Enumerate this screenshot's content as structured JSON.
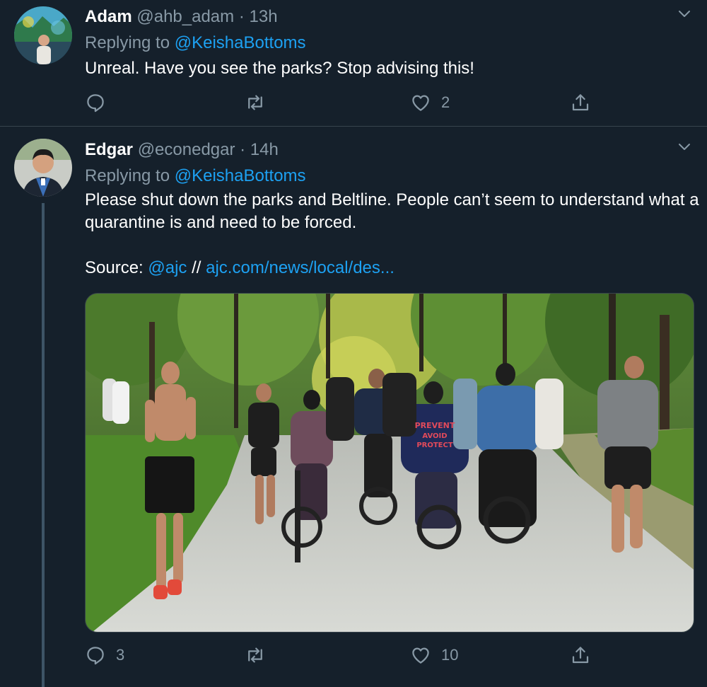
{
  "tweets": [
    {
      "name": "Adam",
      "handle": "@ahb_adam",
      "separator": "·",
      "time": "13h",
      "replying_prefix": "Replying to",
      "replying_to": "@KeishaBottoms",
      "text": "Unreal. Have you see the parks? Stop advising this!",
      "reply_count": "",
      "like_count": "2"
    },
    {
      "name": "Edgar",
      "handle": "@econedgar",
      "separator": "·",
      "time": "14h",
      "replying_prefix": "Replying to",
      "replying_to": "@KeishaBottoms",
      "text": "Please shut down the parks and Beltline. People can’t seem to understand what a quarantine is and need to be forced.",
      "source_label": "Source:",
      "source_mention": "@ajc",
      "source_sep": "//",
      "source_link": "ajc.com/news/local/des...",
      "reply_count": "3",
      "like_count": "10"
    }
  ],
  "colors": {
    "background": "#15202b",
    "secondary_text": "#8899a6",
    "link": "#1da1f2",
    "divider": "#38444d"
  },
  "icons": [
    "reply-icon",
    "retweet-icon",
    "like-icon",
    "share-icon",
    "caret-down-icon"
  ]
}
